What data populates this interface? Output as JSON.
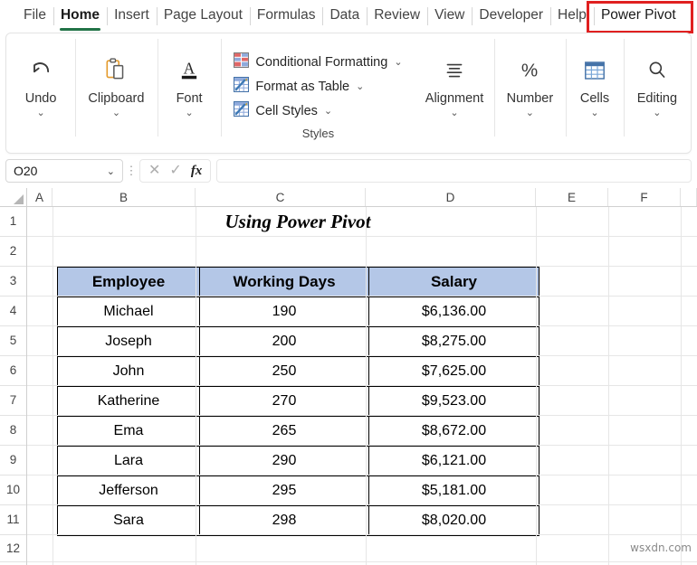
{
  "ribbon": {
    "tabs": [
      {
        "label": "File",
        "active": false,
        "boxed": false
      },
      {
        "label": "Home",
        "active": true,
        "boxed": false
      },
      {
        "label": "Insert",
        "active": false,
        "boxed": false
      },
      {
        "label": "Page Layout",
        "active": false,
        "boxed": false
      },
      {
        "label": "Formulas",
        "active": false,
        "boxed": false
      },
      {
        "label": "Data",
        "active": false,
        "boxed": false
      },
      {
        "label": "Review",
        "active": false,
        "boxed": false
      },
      {
        "label": "View",
        "active": false,
        "boxed": false
      },
      {
        "label": "Developer",
        "active": false,
        "boxed": false
      },
      {
        "label": "Help",
        "active": false,
        "boxed": false
      },
      {
        "label": "Power Pivot",
        "active": false,
        "boxed": true
      }
    ],
    "groups": [
      {
        "label": "Undo",
        "icon": "undo-icon",
        "caret": "⌄"
      },
      {
        "label": "Clipboard",
        "icon": "clipboard-icon",
        "caret": "⌄"
      },
      {
        "label": "Font",
        "icon": "font-icon",
        "caret": "⌄"
      },
      {
        "label": "Alignment",
        "icon": "alignment-icon",
        "caret": "⌄"
      },
      {
        "label": "Number",
        "icon": "percent-icon",
        "caret": "⌄"
      },
      {
        "label": "Cells",
        "icon": "cells-icon",
        "caret": "⌄"
      },
      {
        "label": "Editing",
        "icon": "search-icon",
        "caret": "⌄"
      }
    ],
    "styles": {
      "label": "Styles",
      "items": [
        {
          "label": "Conditional Formatting",
          "caret": "⌄",
          "icon": "conditional-formatting-icon"
        },
        {
          "label": "Format as Table",
          "caret": "⌄",
          "icon": "format-as-table-icon"
        },
        {
          "label": "Cell Styles",
          "caret": "⌄",
          "icon": "cell-styles-icon"
        }
      ]
    },
    "accent_green": "#217346",
    "highlight_red": "#e02020"
  },
  "formula_bar": {
    "name_box_value": "O20",
    "name_box_caret": "⌄",
    "cancel_icon": "✕",
    "confirm_icon": "✓",
    "fx_label": "fx",
    "formula_value": ""
  },
  "grid": {
    "columns": [
      "A",
      "B",
      "C",
      "D",
      "E",
      "F"
    ],
    "rows": [
      "1",
      "2",
      "3",
      "4",
      "5",
      "6",
      "7",
      "8",
      "9",
      "10",
      "11",
      "12"
    ]
  },
  "sheet": {
    "title": "Using Power Pivot",
    "table": {
      "header_fill": "#B4C7E7",
      "headers": [
        "Employee",
        "Working Days",
        "Salary"
      ],
      "rows": [
        [
          "Michael",
          "190",
          "$6,136.00"
        ],
        [
          "Joseph",
          "200",
          "$8,275.00"
        ],
        [
          "John",
          "250",
          "$7,625.00"
        ],
        [
          "Katherine",
          "270",
          "$9,523.00"
        ],
        [
          "Ema",
          "265",
          "$8,672.00"
        ],
        [
          "Lara",
          "290",
          "$6,121.00"
        ],
        [
          "Jefferson",
          "295",
          "$5,181.00"
        ],
        [
          "Sara",
          "298",
          "$8,020.00"
        ]
      ]
    }
  },
  "watermark": "wsxdn.com"
}
